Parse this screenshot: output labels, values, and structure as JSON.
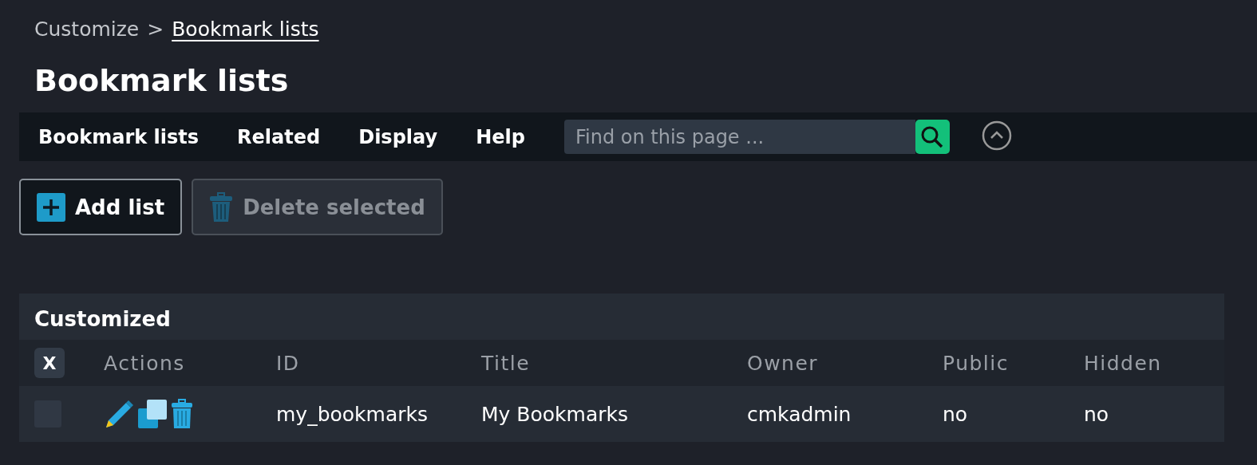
{
  "breadcrumb": [
    {
      "label": "Customize",
      "link": false
    },
    {
      "label": "Bookmark lists",
      "link": true
    }
  ],
  "breadcrumb_separator": ">",
  "title": "Bookmark lists",
  "menu": {
    "items": [
      "Bookmark lists",
      "Related",
      "Display",
      "Help"
    ],
    "search": {
      "placeholder": "Find on this page ..."
    }
  },
  "buttons": [
    {
      "label": "Add list",
      "kind": "add",
      "disabled": false
    },
    {
      "label": "Delete selected",
      "kind": "delete",
      "disabled": true
    }
  ],
  "table": {
    "title": "Customized",
    "toggle_all": "X",
    "columns": [
      "Actions",
      "ID",
      "Title",
      "Owner",
      "Public",
      "Hidden"
    ],
    "rows": [
      {
        "checked": false,
        "cells": [
          "",
          "my_bookmarks",
          "My Bookmarks",
          "cmkadmin",
          "no",
          "no"
        ]
      }
    ]
  }
}
